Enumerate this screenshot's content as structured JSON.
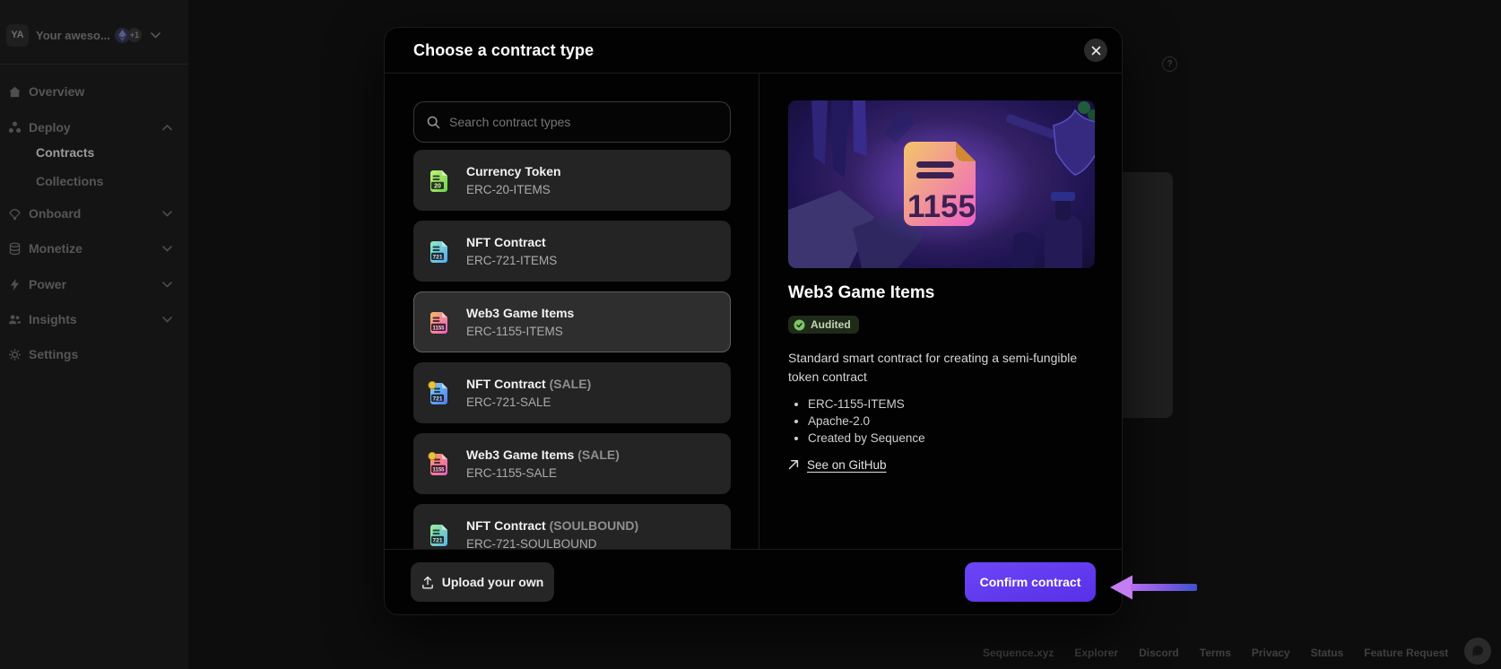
{
  "workspace": {
    "avatar_initials": "YA",
    "name": "Your aweso...",
    "extra_badge": "+1"
  },
  "sidebar": {
    "items": [
      {
        "label": "Overview"
      },
      {
        "label": "Deploy",
        "expanded": true
      },
      {
        "label": "Contracts",
        "active": true
      },
      {
        "label": "Collections"
      },
      {
        "label": "Onboard"
      },
      {
        "label": "Monetize"
      },
      {
        "label": "Power"
      },
      {
        "label": "Insights"
      },
      {
        "label": "Settings"
      }
    ]
  },
  "modal": {
    "title": "Choose a contract type",
    "search_placeholder": "Search contract types",
    "contracts": [
      {
        "title": "Currency Token",
        "suffix": "",
        "code": "ERC-20-ITEMS",
        "selected": false
      },
      {
        "title": "NFT Contract",
        "suffix": "",
        "code": "ERC-721-ITEMS",
        "selected": false
      },
      {
        "title": "Web3 Game Items",
        "suffix": "",
        "code": "ERC-1155-ITEMS",
        "selected": true
      },
      {
        "title": "NFT Contract",
        "suffix": "(SALE)",
        "code": "ERC-721-SALE",
        "selected": false
      },
      {
        "title": "Web3 Game Items",
        "suffix": "(SALE)",
        "code": "ERC-1155-SALE",
        "selected": false
      },
      {
        "title": "NFT Contract",
        "suffix": "(SOULBOUND)",
        "code": "ERC-721-SOULBOUND",
        "selected": false
      }
    ],
    "detail": {
      "hero_label": "1155",
      "title": "Web3 Game Items",
      "badge": "Audited",
      "description": "Standard smart contract for creating a semi-fungible token contract",
      "bullets": [
        "ERC-1155-ITEMS",
        "Apache-2.0",
        "Created by Sequence"
      ],
      "github_link": "See on GitHub"
    },
    "upload_button": "Upload your own",
    "confirm_button": "Confirm contract"
  },
  "page_footer": {
    "links": [
      "Sequence.xyz",
      "Explorer",
      "Discord",
      "Terms",
      "Privacy",
      "Status",
      "Feature Request"
    ]
  },
  "colors": {
    "accent": "#6139ee",
    "badge_green": "#7fc468",
    "annotation_arrow": "#b46ef0",
    "erc20": "#6fd24f",
    "erc721": "#58a8f0",
    "erc1155": "#ee5fc5",
    "sale_coin": "#edc23c"
  },
  "icons": {
    "search": "magnifier",
    "close": "x-cross",
    "audited": "check-circle",
    "github": "arrow-up-right",
    "upload": "arrow-up-tray",
    "annotation": "left-pointing-arrow"
  }
}
